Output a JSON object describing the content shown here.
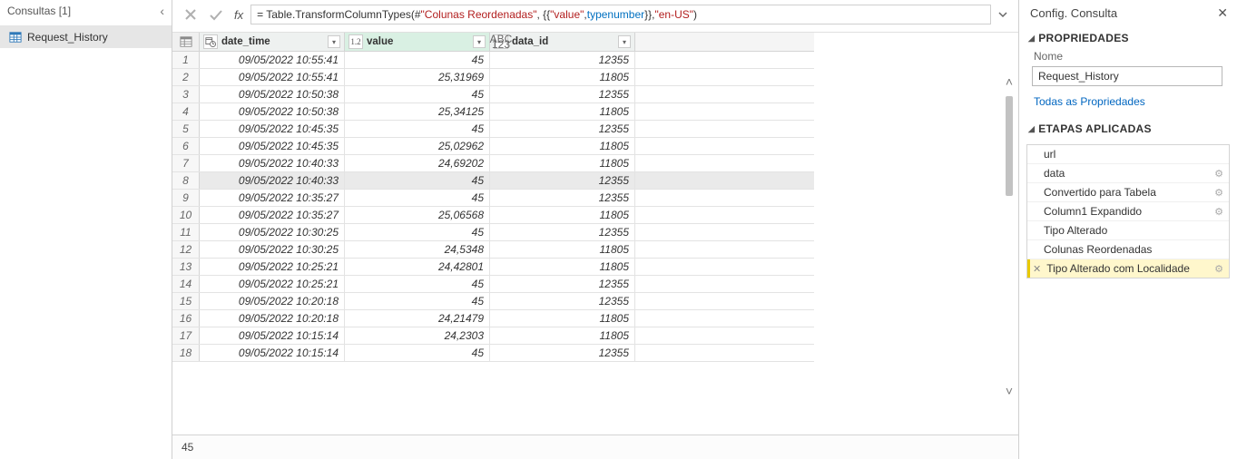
{
  "left": {
    "title": "Consultas [1]",
    "items": [
      {
        "label": "Request_History"
      }
    ]
  },
  "formula": {
    "prefix": "= Table.TransformColumnTypes(#",
    "str1": "\"Colunas Reordenadas\"",
    "mid1": ", {{",
    "str2": "\"value\"",
    "mid2": ", ",
    "kw1": "type",
    "sp1": " ",
    "kw2": "number",
    "mid3": "}}, ",
    "str3": "\"en-US\"",
    "end": ")"
  },
  "columns": {
    "dt_icon": "📅",
    "dt_name": "date_time",
    "val_icon": "1.2",
    "val_name": "value",
    "id_icon_top": "ABC",
    "id_icon_bot": "123",
    "id_name": "data_id"
  },
  "rows": [
    {
      "n": "1",
      "dt": "09/05/2022 10:55:41",
      "val": "45",
      "id": "12355"
    },
    {
      "n": "2",
      "dt": "09/05/2022 10:55:41",
      "val": "25,31969",
      "id": "11805"
    },
    {
      "n": "3",
      "dt": "09/05/2022 10:50:38",
      "val": "45",
      "id": "12355"
    },
    {
      "n": "4",
      "dt": "09/05/2022 10:50:38",
      "val": "25,34125",
      "id": "11805"
    },
    {
      "n": "5",
      "dt": "09/05/2022 10:45:35",
      "val": "45",
      "id": "12355"
    },
    {
      "n": "6",
      "dt": "09/05/2022 10:45:35",
      "val": "25,02962",
      "id": "11805"
    },
    {
      "n": "7",
      "dt": "09/05/2022 10:40:33",
      "val": "24,69202",
      "id": "11805"
    },
    {
      "n": "8",
      "dt": "09/05/2022 10:40:33",
      "val": "45",
      "id": "12355",
      "sel": true
    },
    {
      "n": "9",
      "dt": "09/05/2022 10:35:27",
      "val": "45",
      "id": "12355"
    },
    {
      "n": "10",
      "dt": "09/05/2022 10:35:27",
      "val": "25,06568",
      "id": "11805"
    },
    {
      "n": "11",
      "dt": "09/05/2022 10:30:25",
      "val": "45",
      "id": "12355"
    },
    {
      "n": "12",
      "dt": "09/05/2022 10:30:25",
      "val": "24,5348",
      "id": "11805"
    },
    {
      "n": "13",
      "dt": "09/05/2022 10:25:21",
      "val": "24,42801",
      "id": "11805"
    },
    {
      "n": "14",
      "dt": "09/05/2022 10:25:21",
      "val": "45",
      "id": "12355"
    },
    {
      "n": "15",
      "dt": "09/05/2022 10:20:18",
      "val": "45",
      "id": "12355"
    },
    {
      "n": "16",
      "dt": "09/05/2022 10:20:18",
      "val": "24,21479",
      "id": "11805"
    },
    {
      "n": "17",
      "dt": "09/05/2022 10:15:14",
      "val": "24,2303",
      "id": "11805"
    },
    {
      "n": "18",
      "dt": "09/05/2022 10:15:14",
      "val": "45",
      "id": "12355"
    }
  ],
  "status": "45",
  "right": {
    "title": "Config. Consulta",
    "section1": "PROPRIEDADES",
    "name_label": "Nome",
    "name_value": "Request_History",
    "all_props": "Todas as Propriedades",
    "section2": "ETAPAS APLICADAS",
    "steps": [
      {
        "label": "url",
        "gear": false
      },
      {
        "label": "data",
        "gear": true
      },
      {
        "label": "Convertido para Tabela",
        "gear": true
      },
      {
        "label": "Column1 Expandido",
        "gear": true
      },
      {
        "label": "Tipo Alterado",
        "gear": false
      },
      {
        "label": "Colunas Reordenadas",
        "gear": false
      },
      {
        "label": "Tipo Alterado com Localidade",
        "gear": true,
        "sel": true,
        "x": true
      }
    ]
  }
}
